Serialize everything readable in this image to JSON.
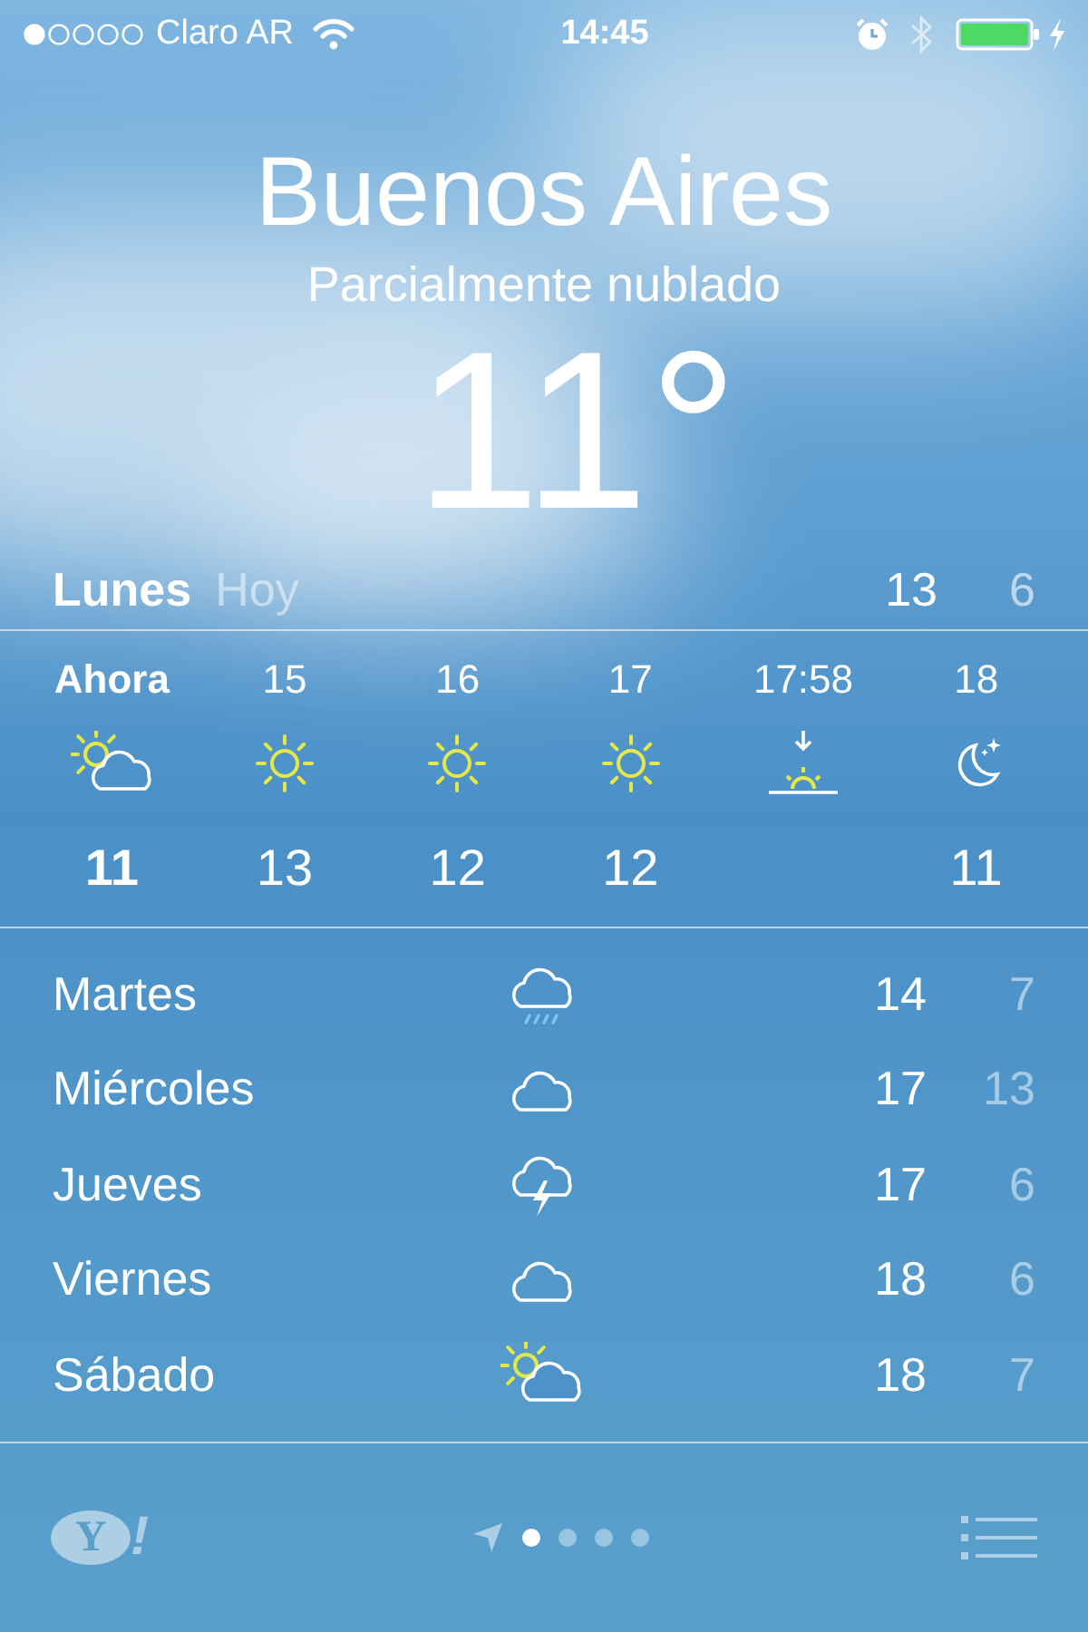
{
  "status_bar": {
    "carrier": "Claro AR",
    "time": "14:45"
  },
  "location": {
    "city": "Buenos Aires",
    "condition": "Parcialmente nublado",
    "temperature": "11°"
  },
  "today": {
    "day": "Lunes",
    "label": "Hoy",
    "high": "13",
    "low": "6"
  },
  "hourly": [
    {
      "time": "Ahora",
      "kind": "sun-cloud",
      "temp": "11",
      "now": true
    },
    {
      "time": "15",
      "kind": "sun",
      "temp": "13",
      "now": false
    },
    {
      "time": "16",
      "kind": "sun",
      "temp": "12",
      "now": false
    },
    {
      "time": "17",
      "kind": "sun",
      "temp": "12",
      "now": false
    },
    {
      "time": "17:58",
      "kind": "sunset",
      "now": false
    },
    {
      "time": "18",
      "kind": "moon",
      "temp": "11",
      "now": false
    }
  ],
  "daily": [
    {
      "day": "Martes",
      "kind": "rain",
      "high": "14",
      "low": "7"
    },
    {
      "day": "Miércoles",
      "kind": "cloud",
      "high": "17",
      "low": "13"
    },
    {
      "day": "Jueves",
      "kind": "storm",
      "high": "17",
      "low": "6"
    },
    {
      "day": "Viernes",
      "kind": "cloud",
      "high": "18",
      "low": "6"
    },
    {
      "day": "Sábado",
      "kind": "sun-cloud",
      "high": "18",
      "low": "7"
    }
  ],
  "footer": {
    "logo_letter": "Y",
    "logo_mark": "!",
    "pages": [
      {
        "selected": true
      },
      {
        "selected": false
      },
      {
        "selected": false
      },
      {
        "selected": false
      }
    ]
  }
}
